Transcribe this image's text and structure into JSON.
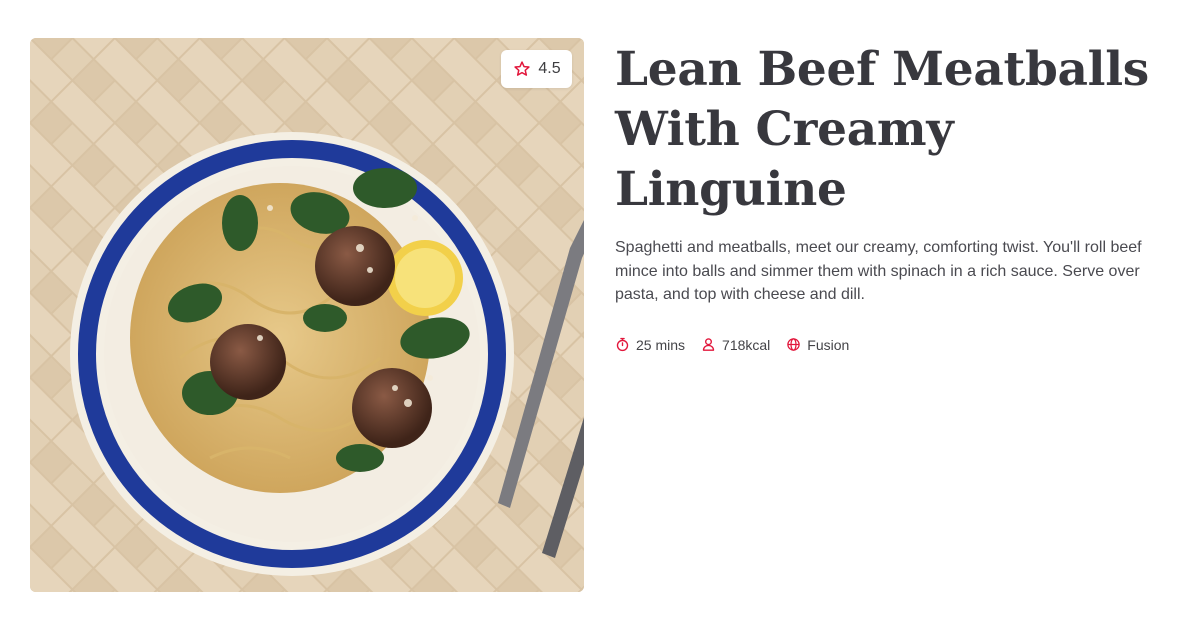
{
  "recipe": {
    "title_line1": "Lean Beef Meatballs",
    "title_line2": "With Creamy Linguine",
    "description": "Spaghetti and meatballs, meet our creamy, comforting twist. You'll roll beef mince into balls and simmer them with spinach in a rich sauce. Serve over pasta, and top with cheese and dill.",
    "image_icon": "recipe-photo",
    "rating": {
      "value": "4.5",
      "icon": "star-icon"
    },
    "meta": {
      "time": {
        "icon": "timer-icon",
        "label": "25 mins"
      },
      "calories": {
        "icon": "person-icon",
        "label": "718kcal"
      },
      "cuisine": {
        "icon": "globe-icon",
        "label": "Fusion"
      }
    }
  },
  "colors": {
    "accent": "#e2173c",
    "title": "#38383e",
    "body_text": "#4a4a50",
    "plate_rim": "#1f3a9a"
  }
}
